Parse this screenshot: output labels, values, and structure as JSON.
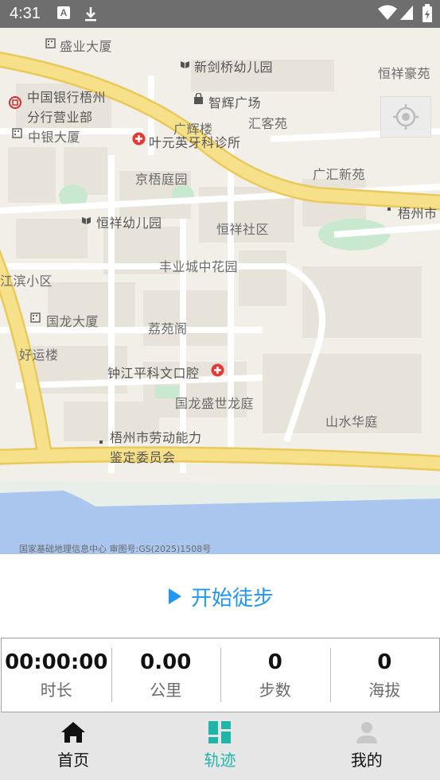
{
  "status_bar": {
    "time": "4:31"
  },
  "map": {
    "labels": [
      {
        "text": "盛业大厦",
        "icon": "building-icon"
      },
      {
        "text": "新剑桥幼儿园",
        "icon": "school-icon"
      },
      {
        "text": "恒祥豪苑",
        "icon": ""
      },
      {
        "text": "中国银行梧州",
        "icon": "bank-icon"
      },
      {
        "text": "分行营业部",
        "icon": ""
      },
      {
        "text": "智辉广场",
        "icon": "shopping-icon"
      },
      {
        "text": "汇客苑",
        "icon": ""
      },
      {
        "text": "中银大厦",
        "icon": "building-icon"
      },
      {
        "text": "广辉楼",
        "icon": ""
      },
      {
        "text": "叶元英牙科诊所",
        "icon": "hospital-icon"
      },
      {
        "text": "京梧庭园",
        "icon": ""
      },
      {
        "text": "广汇新苑",
        "icon": ""
      },
      {
        "text": "梧州市",
        "icon": "dot-icon"
      },
      {
        "text": "恒祥幼儿园",
        "icon": "school-icon"
      },
      {
        "text": "恒祥社区",
        "icon": ""
      },
      {
        "text": "丰业城中花园",
        "icon": ""
      },
      {
        "text": "江滨小区",
        "icon": ""
      },
      {
        "text": "国龙大厦",
        "icon": "building-icon"
      },
      {
        "text": "荔苑阁",
        "icon": ""
      },
      {
        "text": "好运楼",
        "icon": ""
      },
      {
        "text": "钟江平科文口腔",
        "icon": "hospital-icon"
      },
      {
        "text": "国龙盛世龙庭",
        "icon": ""
      },
      {
        "text": "山水华庭",
        "icon": ""
      },
      {
        "text": "梧州市劳动能力",
        "icon": "dot-icon"
      },
      {
        "text": "鉴定委员会",
        "icon": ""
      }
    ],
    "credit": "国家基础地理信息中心 审图号:GS(2025)1508号",
    "colors": {
      "road": "#f7e08a",
      "road_edge": "#e8c95a",
      "water": "#aac6ee",
      "green": "#c8e8cf",
      "land": "#f2efe8"
    }
  },
  "start_button": {
    "label": "开始徒步",
    "color": "#2196f3"
  },
  "stats": [
    {
      "value": "00:00:00",
      "label": "时长"
    },
    {
      "value": "0.00",
      "label": "公里"
    },
    {
      "value": "0",
      "label": "步数"
    },
    {
      "value": "0",
      "label": "海拔"
    }
  ],
  "bottom_nav": [
    {
      "label": "首页",
      "icon": "home-icon"
    },
    {
      "label": "轨迹",
      "icon": "dashboard-icon",
      "active": true,
      "active_color": "#1fb5a8"
    },
    {
      "label": "我的",
      "icon": "person-icon"
    }
  ]
}
